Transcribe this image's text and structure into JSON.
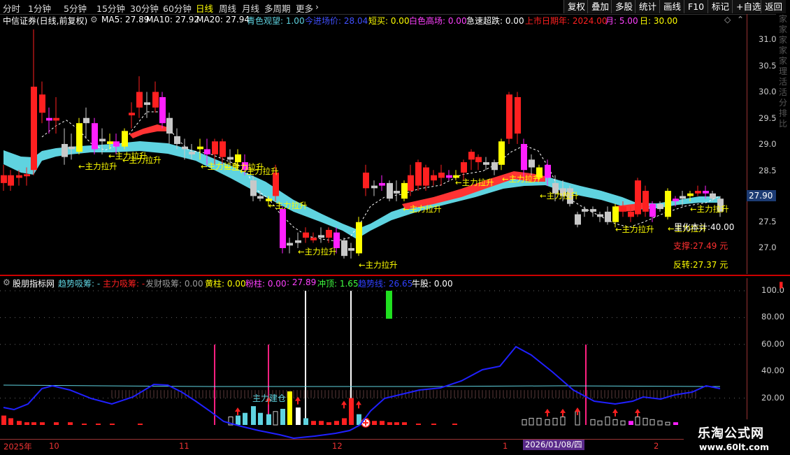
{
  "toolbar": {
    "periods": [
      "分时",
      "1分钟",
      "5分钟",
      "15分钟",
      "30分钟",
      "60分钟",
      "日线",
      "周线",
      "月线",
      "多周期",
      "更多"
    ],
    "active_period": "日线",
    "right_buttons": [
      "复权",
      "叠加",
      "多股",
      "统计",
      "画线",
      "F10",
      "标记",
      "+自选",
      "返回"
    ]
  },
  "main_info": {
    "stock": "中信证券(日线,前复权)",
    "ma5": "MA5: 27.89",
    "ma10": "MA10: 27.92",
    "ma20": "MA20: 27.94",
    "qingse": "青色观望: 1.00",
    "jinjin": "今进场价: 28.04",
    "duanmai": "短买: 0.00",
    "baise": "白色高场: 0.00",
    "jisu": "急速超跌: 0.00",
    "shangshi": "上市日期年: 2024.00",
    "yue": "月: 5.00",
    "ri": "日: 30.00"
  },
  "y_axis_main": [
    "31.00",
    "30.50",
    "30.00",
    "29.50",
    "29.00",
    "28.50",
    "28.00",
    "27.50",
    "27.00"
  ],
  "current_price": "27.90",
  "price_labels": {
    "support": "支撑:27.49 元",
    "reverse": "反转:27.37 元",
    "cost": "里化本计:40.00"
  },
  "flag_text": "←主力拉升",
  "indicator_info": {
    "name": "股朋指标网",
    "qushi": "趋势吸筹: -",
    "zhuli": "主力吸筹: -",
    "facai": "发财吸筹: 0.00",
    "huangzhu": "黄柱: 0.00",
    "fenzhu": "粉柱: 0.00",
    "val": ": 27.89",
    "chongding": "冲顶: 1.65",
    "qushixian": "趋势线: 26.65",
    "niugu": "牛股: 0.00"
  },
  "jiancang": "主力建仓",
  "y_axis_ind": [
    "100.0",
    "80.00",
    "60.00",
    "40.00",
    "20.00"
  ],
  "time_axis": [
    "2025年",
    "10",
    "11",
    "12",
    "1",
    "2"
  ],
  "selected_date": "2026/01/08/四",
  "right_strip_text": "家家家家家理活活分排比",
  "watermark_cn": "乐淘公式网",
  "watermark_url": "www.60lt.com",
  "colors": {
    "up": "#ff2020",
    "down": "#c8c8c8",
    "yellow": "#ffff00",
    "magenta": "#ff20ff",
    "cyan": "#5fd3e0",
    "blue": "#2020ff",
    "pink": "#ff2080"
  }
}
